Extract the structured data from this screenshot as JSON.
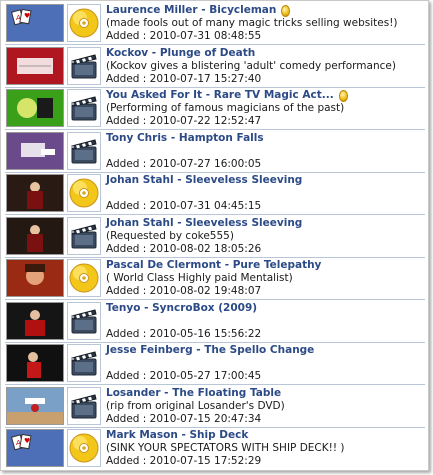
{
  "items": [
    {
      "title": "Laurence Miller - Bicycleman",
      "desc": "(made fools out of many magic tricks selling websites!)",
      "added": "Added : 2010-07-31 08:48:55",
      "media": "dvd-icon",
      "gold": true,
      "thumb_color": "#4d6fb8"
    },
    {
      "title": "Kockov - Plunge of Death",
      "desc": "(Kockov gives a blistering 'adult' comedy performance)",
      "added": "Added : 2010-07-17 15:27:40",
      "media": "clapperboard-icon",
      "gold": false,
      "thumb_color": "#b01620"
    },
    {
      "title": "You Asked For It - Rare TV Magic Act...",
      "desc": "(Performing of famous magicians of the past)",
      "added": "Added : 2010-07-22 12:52:47",
      "media": "clapperboard-icon",
      "gold": true,
      "thumb_color": "#3aa01a"
    },
    {
      "title": "Tony Chris - Hampton Falls",
      "desc": "",
      "added": "Added : 2010-07-27 16:00:05",
      "media": "clapperboard-icon",
      "gold": false,
      "thumb_color": "#6a4a8a"
    },
    {
      "title": "Johan Stahl - Sleeveless Sleeving",
      "desc": "",
      "added": "Added : 2010-07-31 04:45:15",
      "media": "dvd-icon",
      "gold": false,
      "thumb_color": "#2a1a14"
    },
    {
      "title": "Johan Stahl - Sleeveless Sleeving",
      "desc": "(Requested by coke555)",
      "added": "Added : 2010-08-02 18:05:26",
      "media": "clapperboard-icon",
      "gold": false,
      "thumb_color": "#241812"
    },
    {
      "title": "Pascal De Clermont - Pure Telepathy",
      "desc": "( World Class Highly paid Mentalist)",
      "added": "Added : 2010-08-02 19:48:07",
      "media": "dvd-icon",
      "gold": false,
      "thumb_color": "#9a2a14"
    },
    {
      "title": "Tenyo - SyncroBox (2009)",
      "desc": "",
      "added": "Added : 2010-05-16 15:56:22",
      "media": "clapperboard-icon",
      "gold": false,
      "thumb_color": "#151515"
    },
    {
      "title": "Jesse Feinberg - The Spello Change",
      "desc": "",
      "added": "Added : 2010-05-27 17:00:45",
      "media": "clapperboard-icon",
      "gold": false,
      "thumb_color": "#101010"
    },
    {
      "title": "Losander - The Floating Table",
      "desc": "(rip from original Losander's DVD)",
      "added": "Added : 2010-07-15 20:47:34",
      "media": "clapperboard-icon",
      "gold": false,
      "thumb_color": "#7aa0c8"
    },
    {
      "title": "Mark Mason - Ship Deck",
      "desc": "(SINK YOUR SPECTATORS WITH SHIP DECK!! )",
      "added": "Added : 2010-07-15 17:52:29",
      "media": "dvd-icon",
      "gold": false,
      "thumb_color": "#4d6fb8"
    }
  ],
  "colors": {
    "title": "#2b4a86",
    "divider": "#b8c6d8",
    "gold": "#f0c020"
  }
}
